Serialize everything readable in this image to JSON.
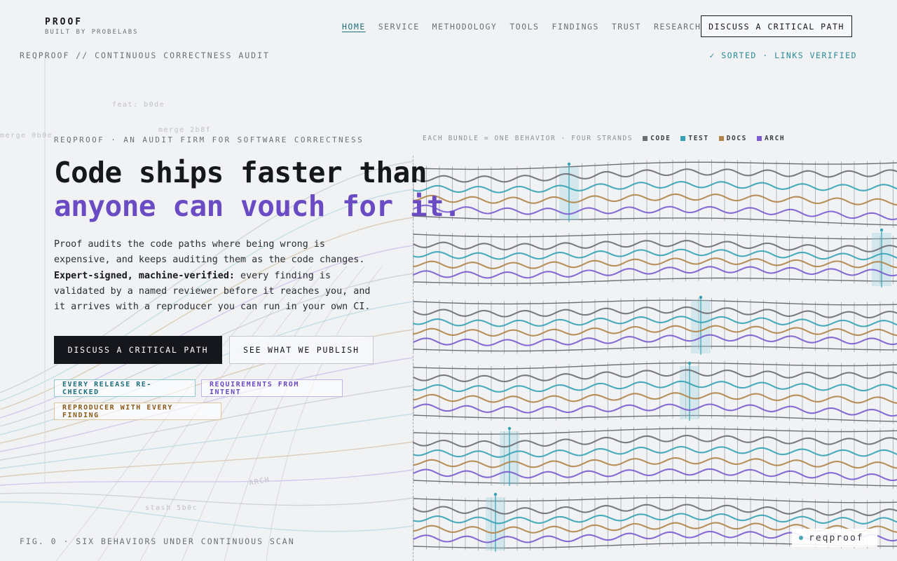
{
  "brand": {
    "name": "PROOF",
    "sub": "BUILT BY PROBELABS"
  },
  "nav": {
    "links": [
      {
        "label": "HOME",
        "active": true
      },
      {
        "label": "SERVICE"
      },
      {
        "label": "METHODOLOGY"
      },
      {
        "label": "TOOLS"
      },
      {
        "label": "FINDINGS"
      },
      {
        "label": "TRUST"
      },
      {
        "label": "RESEARCH"
      }
    ],
    "cta": "DISCUSS A CRITICAL PATH"
  },
  "subbar": {
    "left": "REQPROOF // CONTINUOUS CORRECTNESS AUDIT",
    "right": "✓ SORTED · LINKS VERIFIED"
  },
  "hero": {
    "eyebrow": "REQPROOF · AN AUDIT FIRM FOR SOFTWARE CORRECTNESS",
    "headline_line1": "Code ships faster than",
    "headline_line2": "anyone can vouch for it.",
    "lede_1": "Proof audits the code paths where being wrong is expensive, and keeps auditing them as the code changes. ",
    "lede_bold": "Expert-signed, machine-verified:",
    "lede_2": " every finding is validated by a named reviewer before it reaches you, and it arrives with a reproducer you can run in your own CI.",
    "primary_button": "DISCUSS A CRITICAL PATH",
    "secondary_button": "SEE WHAT WE PUBLISH",
    "tags": [
      "EVERY RELEASE RE-CHECKED",
      "REQUIREMENTS FROM INTENT",
      "REPRODUCER WITH EVERY FINDING"
    ]
  },
  "figure": {
    "legend_caption": "EACH BUNDLE = ONE BEHAVIOR · FOUR STRANDS",
    "strands": [
      {
        "name": "CODE",
        "color": "#6b6e74"
      },
      {
        "name": "TEST",
        "color": "#35a3b5"
      },
      {
        "name": "DOCS",
        "color": "#b08448"
      },
      {
        "name": "ARCH",
        "color": "#7a5cd0"
      }
    ],
    "bundle_count": 6,
    "caption": "FIG. 0 · SIX BEHAVIORS UNDER CONTINUOUS SCAN",
    "background_labels": [
      "feat: b0de",
      "merge 0b0e",
      "merge 2b8f",
      "stash 5b0c",
      "ARCH"
    ]
  },
  "badge": {
    "label": "reqproof"
  },
  "colors": {
    "accent_purple": "#6a4bc4",
    "accent_teal": "#1d6f7a",
    "ink": "#15171c"
  }
}
